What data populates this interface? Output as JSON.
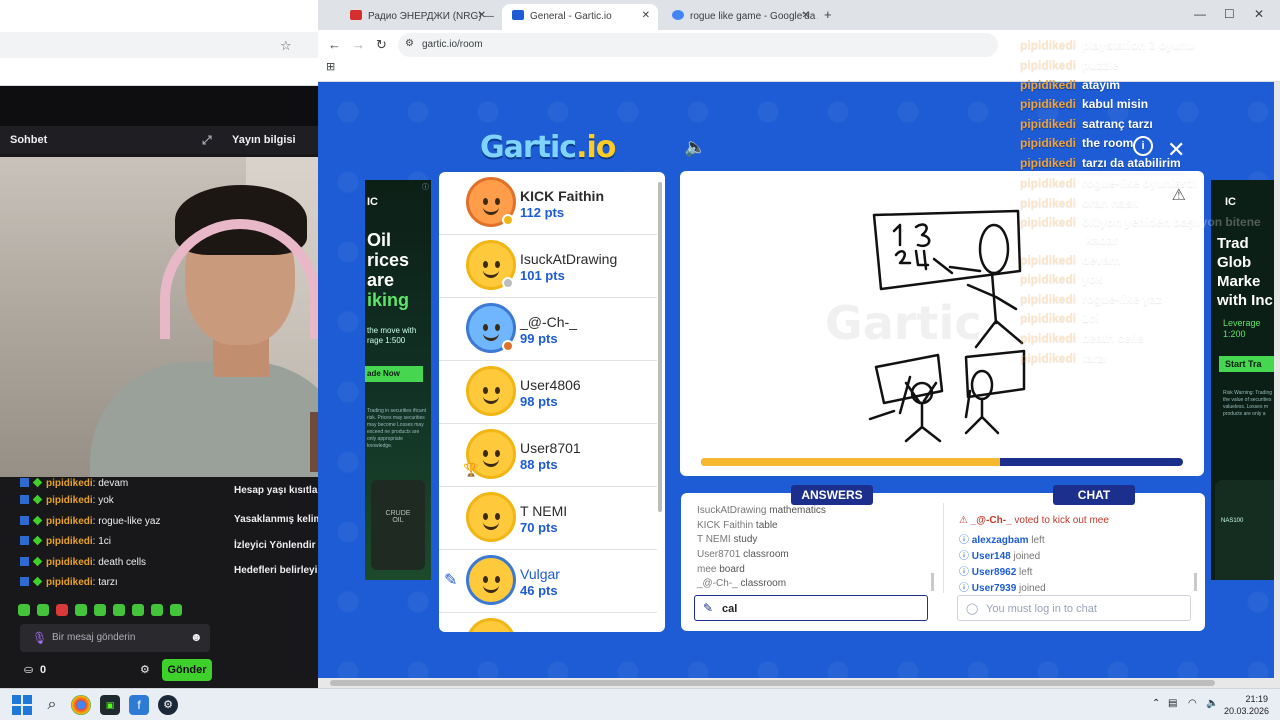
{
  "twitch": {
    "chat_tab": "Sohbet",
    "info_tab": "Yayın bilgisi",
    "chat_lines": [
      {
        "user": "pipidikedi",
        "text": "devam"
      },
      {
        "user": "pipidikedi",
        "text": "yok"
      },
      {
        "user": "pipidikedi",
        "text": "rogue-like yaz"
      },
      {
        "user": "pipidikedi",
        "text": "1ci"
      },
      {
        "user": "pipidikedi",
        "text": "death cells"
      },
      {
        "user": "pipidikedi",
        "text": "tarzı"
      }
    ],
    "message_placeholder": "Bir mesaj gönderin",
    "points": "0",
    "send_label": "Gönder",
    "info_items": [
      "Hesap yaşı kısıtlam",
      "Yasaklanmış kelim",
      "İzleyici Yönlendir",
      "Hedefleri belirleyin"
    ]
  },
  "browser": {
    "tabs": [
      {
        "title": "Радио ЭНЕРДЖИ (NRG) — ",
        "favicon_color": "#d62d2d"
      },
      {
        "title": "General - Gartic.io",
        "favicon_color": "#1d5cd4"
      },
      {
        "title": "rogue like game - Google'da A",
        "favicon_color": "#4285f4"
      }
    ],
    "url": "gartic.io/room"
  },
  "game": {
    "logo_main": "Gartic",
    "logo_suffix": ".io",
    "players": [
      {
        "name": "KICK Faithin",
        "points": "112 pts",
        "status_color": "#f1b514",
        "avatar": "orange"
      },
      {
        "name": "IsuckAtDrawing",
        "points": "101 pts",
        "status_color": "#bcbcbc",
        "avatar": "plain"
      },
      {
        "name": "_@-Ch-_",
        "points": "99 pts",
        "status_color": "#e0702a",
        "avatar": "blue"
      },
      {
        "name": "User4806",
        "points": "98 pts",
        "status_color": "",
        "avatar": "plain"
      },
      {
        "name": "User8701",
        "points": "88 pts",
        "status_color": "",
        "avatar": "plain",
        "trophy": true
      },
      {
        "name": "T NEMI",
        "points": "70 pts",
        "status_color": "",
        "avatar": "plain"
      },
      {
        "name": "Vulgar",
        "points": "46 pts",
        "status_color": "",
        "avatar": "plain",
        "drawing": true
      }
    ],
    "round_progress": 0.62,
    "answers_title": "ANSWERS",
    "chat_title": "CHAT",
    "answers": [
      {
        "who": "IsuckAtDrawing",
        "guess": "mathematics"
      },
      {
        "who": "KICK Faithin",
        "guess": "table"
      },
      {
        "who": "T NEMI",
        "guess": "study"
      },
      {
        "who": "User8701",
        "guess": "classroom"
      },
      {
        "who": "mee",
        "guess": "board"
      },
      {
        "who": "_@-Ch-_",
        "guess": "classroom"
      }
    ],
    "answer_input_value": "cal",
    "chat_events": [
      {
        "type": "kick",
        "nick": "_@-Ch-_",
        "msg": " voted to kick out mee"
      },
      {
        "type": "info",
        "nick": "alexzagbam",
        "msg": " left"
      },
      {
        "type": "info",
        "nick": "User148",
        "msg": " joined"
      },
      {
        "type": "info",
        "nick": "User8962",
        "msg": " left"
      },
      {
        "type": "info",
        "nick": "User7939",
        "msg": " joined"
      }
    ],
    "chat_placeholder": "You must log in to chat"
  },
  "ads": {
    "left_headline": "Oil\nrices\nare\n",
    "left_highlight": "iking",
    "left_sub": "the move with\nrage 1:500",
    "left_cta": "ade Now",
    "left_fine": "Trading in securities ificant risk. Prices may securities may become Losses may exceed ne products are only appropriate knowledge.",
    "left_barrel": "CRUDE\nOIL",
    "right_headline": "Trad\nGlob\nMarke\nwith Inc",
    "right_sub": "Leverage\n1:200",
    "right_cta": "Start Tra",
    "right_fine": "Risk Warning: Trading the value of securities valueless. Losses m products are only a",
    "right_phone": "NAS100"
  },
  "overlay_chat": [
    {
      "user": "pipidikedi",
      "text": "playstation 3 oyunu",
      "faded": true
    },
    {
      "user": "pipidikedi",
      "text": "puzzle",
      "faded": true
    },
    {
      "user": "pipidikedi",
      "text": "atayim",
      "faded": false
    },
    {
      "user": "pipidikedi",
      "text": "kabul misin",
      "faded": false
    },
    {
      "user": "pipidikedi",
      "text": "satranç tarzı",
      "faded": false
    },
    {
      "user": "pipidikedi",
      "text": "the room",
      "faded": false
    },
    {
      "user": "pipidikedi",
      "text": "tarzı da atabilirim",
      "faded": false
    },
    {
      "user": "pipidikedi",
      "text": "rogue-like oyunlardı",
      "faded": true
    },
    {
      "user": "pipidikedi",
      "text": "oran nasıl",
      "faded": true
    },
    {
      "user": "pipidikedi",
      "text": "ölüyon yeniden başlıyon bitene",
      "faded": true
    },
    {
      "user": "",
      "text": "kadar",
      "faded": true
    },
    {
      "user": "pipidikedi",
      "text": "devam",
      "faded": true
    },
    {
      "user": "pipidikedi",
      "text": "yok",
      "faded": true
    },
    {
      "user": "pipidikedi",
      "text": "rogue-like yaz",
      "faded": true
    },
    {
      "user": "pipidikedi",
      "text": "1ci",
      "faded": true
    },
    {
      "user": "pipidikedi",
      "text": "death cells",
      "faded": true
    },
    {
      "user": "pipidikedi",
      "text": "tarzı",
      "faded": true
    }
  ],
  "taskbar": {
    "time": "21:19",
    "date": "20.03.2026"
  }
}
